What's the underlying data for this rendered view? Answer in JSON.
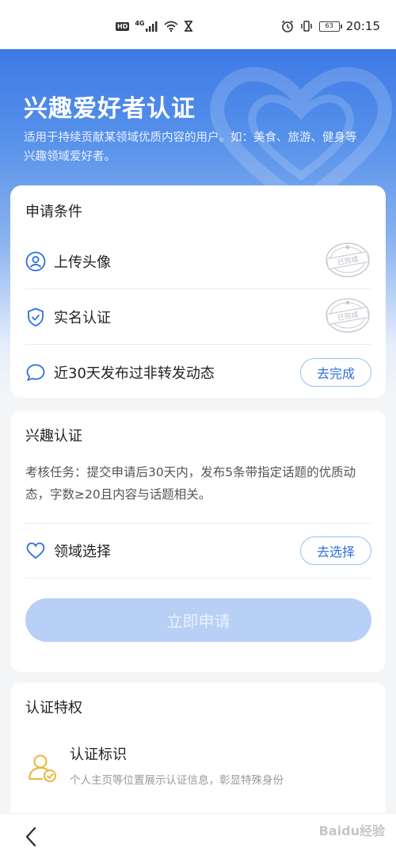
{
  "status_bar": {
    "hd": "HD",
    "network": "4G",
    "battery": "63",
    "time": "20:15"
  },
  "hero": {
    "title": "兴趣爱好者认证",
    "subtitle": "适用于持续贡献某领域优质内容的用户。如：美食、旅游、健身等兴趣领域爱好者。"
  },
  "conditions": {
    "title": "申请条件",
    "items": [
      {
        "label": "上传头像",
        "status": "已完成",
        "icon": "avatar-icon"
      },
      {
        "label": "实名认证",
        "status": "已完成",
        "icon": "shield-check-icon"
      },
      {
        "label": "近30天发布过非转发动态",
        "action": "去完成",
        "icon": "chat-bubble-icon"
      }
    ]
  },
  "interest": {
    "title": "兴趣认证",
    "description": "考核任务：提交申请后30天内，发布5条带指定话题的优质动态，字数≥20且内容与话题相关。",
    "field_label": "领域选择",
    "field_action": "去选择",
    "apply_label": "立即申请"
  },
  "privileges": {
    "title": "认证特权",
    "items": [
      {
        "title": "认证标识",
        "desc": "个人主页等位置展示认证信息，彰显特殊身份"
      }
    ]
  },
  "watermark": "Baidu经验",
  "colors": {
    "accent": "#2f6ee0",
    "hero_top": "#3e7ae6",
    "apply_disabled": "#b9d0f6",
    "badge_gold": "#e8b53a"
  }
}
